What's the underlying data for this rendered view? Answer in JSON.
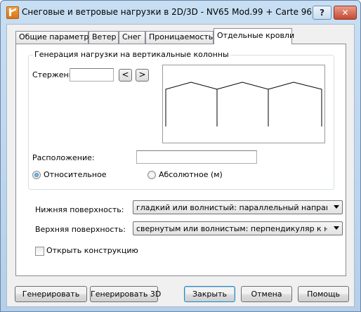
{
  "window": {
    "title": "Снеговые и ветровые нагрузки в 2D/3D - NV65 Mod.99 + Carte 96",
    "help_label": "?",
    "close_label": "✕"
  },
  "tabs": [
    {
      "label": "Общие параметры"
    },
    {
      "label": "Ветер"
    },
    {
      "label": "Снег"
    },
    {
      "label": "Проницаемость"
    },
    {
      "label": "Отдельные кровли",
      "active": true
    }
  ],
  "group": {
    "title": "Генерация нагрузки на вертикальные колонны",
    "member_label": "Стержень",
    "member_value": "",
    "prev_label": "<",
    "next_label": ">",
    "location_label": "Расположение:",
    "location_value": "",
    "radio_relative": {
      "label": "Относительное",
      "checked": true
    },
    "radio_absolute": {
      "label": "Абсолютное (м)",
      "checked": false
    }
  },
  "lower_surface": {
    "label": "Нижняя поверхность:",
    "value": "гладкий или волнистый: параллельный направлению"
  },
  "upper_surface": {
    "label": "Верхняя поверхность:",
    "value": "свернутым или волнистым: перпендикуляр к направл"
  },
  "open_structure": {
    "label": "Открыть конструкцию",
    "checked": false
  },
  "buttons": {
    "generate": "Генерировать",
    "generate_3d": "Генерировать 3D",
    "close": "Закрыть",
    "cancel": "Отмена",
    "help": "Помощь"
  }
}
